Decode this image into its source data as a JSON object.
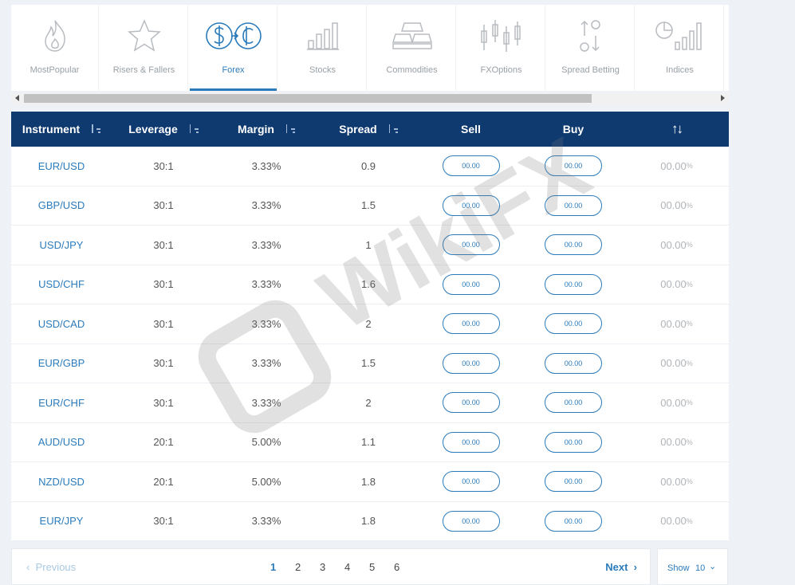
{
  "tabs": [
    {
      "label": "MostPopular",
      "icon": "flame-icon"
    },
    {
      "label": "Risers & Fallers",
      "icon": "star-icon"
    },
    {
      "label": "Forex",
      "icon": "currency-exchange-icon",
      "active": true
    },
    {
      "label": "Stocks",
      "icon": "bar-chart-icon"
    },
    {
      "label": "Commodities",
      "icon": "gold-bars-icon"
    },
    {
      "label": "FXOptions",
      "icon": "candlestick-icon"
    },
    {
      "label": "Spread Betting",
      "icon": "spread-arrows-icon"
    },
    {
      "label": "Indices",
      "icon": "pie-bars-icon"
    }
  ],
  "table": {
    "headers": {
      "instrument": "Instrument",
      "leverage": "Leverage",
      "margin": "Margin",
      "spread": "Spread",
      "sell": "Sell",
      "buy": "Buy",
      "change": "↑↓"
    },
    "rows": [
      {
        "instrument": "EUR/USD",
        "leverage": "30:1",
        "margin": "3.33%",
        "spread": "0.9",
        "sell": "00.00",
        "buy": "00.00",
        "change": "00.00",
        "unit": "%"
      },
      {
        "instrument": "GBP/USD",
        "leverage": "30:1",
        "margin": "3.33%",
        "spread": "1.5",
        "sell": "00.00",
        "buy": "00.00",
        "change": "00.00",
        "unit": "%"
      },
      {
        "instrument": "USD/JPY",
        "leverage": "30:1",
        "margin": "3.33%",
        "spread": "1",
        "sell": "00.00",
        "buy": "00.00",
        "change": "00.00",
        "unit": "%"
      },
      {
        "instrument": "USD/CHF",
        "leverage": "30:1",
        "margin": "3.33%",
        "spread": "1.6",
        "sell": "00.00",
        "buy": "00.00",
        "change": "00.00",
        "unit": "%"
      },
      {
        "instrument": "USD/CAD",
        "leverage": "30:1",
        "margin": "3.33%",
        "spread": "2",
        "sell": "00.00",
        "buy": "00.00",
        "change": "00.00",
        "unit": "%"
      },
      {
        "instrument": "EUR/GBP",
        "leverage": "30:1",
        "margin": "3.33%",
        "spread": "1.5",
        "sell": "00.00",
        "buy": "00.00",
        "change": "00.00",
        "unit": "%"
      },
      {
        "instrument": "EUR/CHF",
        "leverage": "30:1",
        "margin": "3.33%",
        "spread": "2",
        "sell": "00.00",
        "buy": "00.00",
        "change": "00.00",
        "unit": "%"
      },
      {
        "instrument": "AUD/USD",
        "leverage": "20:1",
        "margin": "5.00%",
        "spread": "1.1",
        "sell": "00.00",
        "buy": "00.00",
        "change": "00.00",
        "unit": "%"
      },
      {
        "instrument": "NZD/USD",
        "leverage": "20:1",
        "margin": "5.00%",
        "spread": "1.8",
        "sell": "00.00",
        "buy": "00.00",
        "change": "00.00",
        "unit": "%"
      },
      {
        "instrument": "EUR/JPY",
        "leverage": "30:1",
        "margin": "3.33%",
        "spread": "1.8",
        "sell": "00.00",
        "buy": "00.00",
        "change": "00.00",
        "unit": "%"
      }
    ]
  },
  "pagination": {
    "prev_label": "Previous",
    "next_label": "Next",
    "pages": [
      "1",
      "2",
      "3",
      "4",
      "5",
      "6"
    ],
    "current": "1",
    "show_label": "Show",
    "show_value": "10"
  },
  "watermark": {
    "text": "WikiFX"
  },
  "colors": {
    "accent": "#2b7bbb",
    "header_bg": "#0f3a70"
  }
}
